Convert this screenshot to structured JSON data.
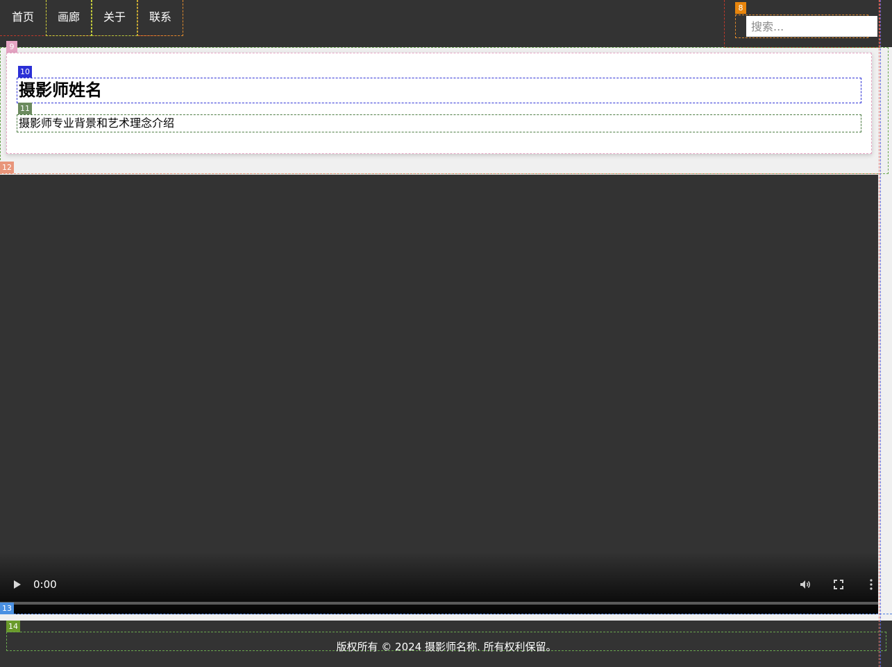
{
  "nav": {
    "items": [
      {
        "label": "首页"
      },
      {
        "label": "画廊"
      },
      {
        "label": "关于"
      },
      {
        "label": "联系"
      }
    ]
  },
  "search": {
    "placeholder": "搜索...",
    "value": ""
  },
  "intro": {
    "title": "摄影师姓名",
    "description": "摄影师专业背景和艺术理念介绍"
  },
  "video": {
    "time": "0:00",
    "icons": {
      "play": "play-icon",
      "volume": "volume-icon",
      "fullscreen": "fullscreen-icon",
      "more": "more-options-icon"
    }
  },
  "footer": {
    "text": "版权所有 © 2024 摄影师名称. 所有权利保留。"
  },
  "badges": {
    "b8": "8",
    "b9": "9",
    "b10": "10",
    "b11": "11",
    "b12": "12",
    "b13": "13",
    "b14": "14"
  },
  "colors": {
    "bar_bg": "#333333",
    "card_bg": "#ffffff",
    "badge8": "#e8850c",
    "badge9": "#e6a5c4",
    "badge10": "#2b2fd6",
    "badge11": "#6b8a5e",
    "badge12": "#e8957a",
    "badge13": "#4a90e2",
    "badge14": "#6a9a2a"
  }
}
